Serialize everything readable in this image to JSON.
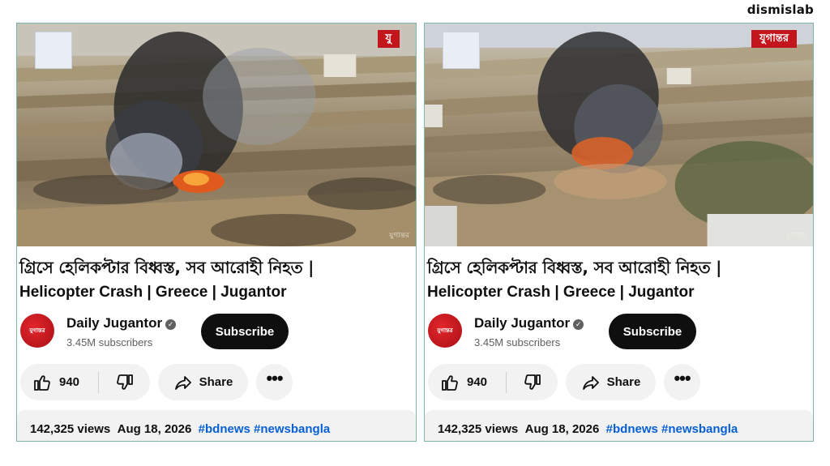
{
  "brand": "dismislab",
  "panels": [
    {
      "title_bn": "গ্রিসে হেলিকপ্টার বিধ্বস্ত, সব আরোহী নিহত |",
      "title_en": "Helicopter Crash | Greece | Jugantor",
      "channel": {
        "name": "Daily Jugantor",
        "subscribers": "3.45M subscribers",
        "avatar_text": "যুগান্তর"
      },
      "subscribe_label": "Subscribe",
      "likes": "940",
      "share_label": "Share",
      "more_label": "•••",
      "views": "142,325 views",
      "date": "Aug 18, 2026",
      "tags": "#bdnews #newsbangla",
      "video": {
        "logo": "যু",
        "watermark": "যুগান্তর"
      }
    },
    {
      "title_bn": "গ্রিসে হেলিকপ্টার বিধ্বস্ত, সব আরোহী নিহত |",
      "title_en": "Helicopter Crash | Greece | Jugantor",
      "channel": {
        "name": "Daily Jugantor",
        "subscribers": "3.45M subscribers",
        "avatar_text": "যুগান্তর"
      },
      "subscribe_label": "Subscribe",
      "likes": "940",
      "share_label": "Share",
      "more_label": "•••",
      "views": "142,325 views",
      "date": "Aug 18, 2026",
      "tags": "#bdnews #newsbangla",
      "video": {
        "logo": "যুগান্তর",
        "watermark": "যুগান্তর"
      }
    }
  ],
  "colors": {
    "accent_link": "#065fd4",
    "brand_red": "#c2161c",
    "button_dark": "#0f0f0f",
    "pill_bg": "#f2f2f2"
  },
  "icons": [
    "thumbs-up-icon",
    "thumbs-down-icon",
    "share-arrow-icon",
    "more-dots-icon",
    "verified-badge-icon"
  ]
}
